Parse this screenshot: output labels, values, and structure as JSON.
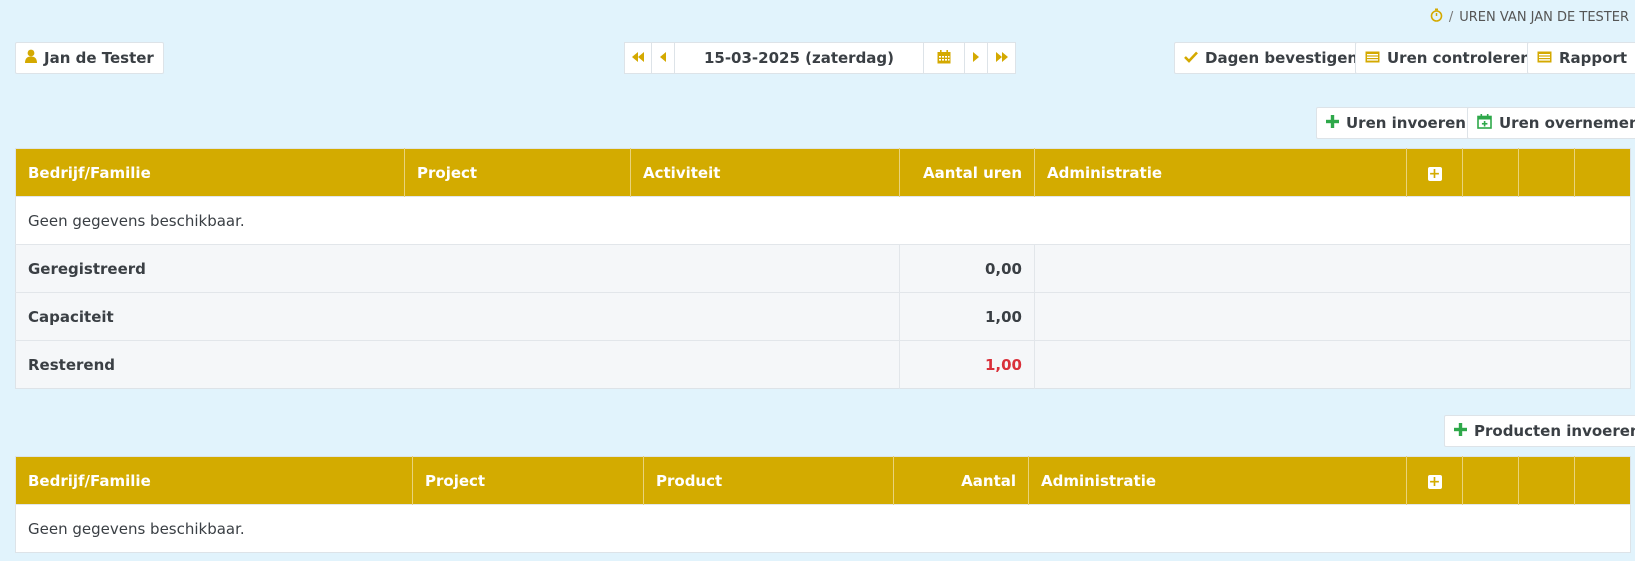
{
  "breadcrumb": {
    "icon": "stopwatch-icon",
    "separator": "/",
    "label": "UREN VAN JAN DE TESTER"
  },
  "user_button": {
    "icon": "user-icon",
    "label": "Jan de Tester"
  },
  "date_nav": {
    "first_icon": "double-chevron-left-icon",
    "prev_icon": "chevron-left-icon",
    "date": "15-03-2025 (zaterdag)",
    "calendar_icon": "calendar-icon",
    "next_icon": "chevron-right-icon",
    "last_icon": "double-chevron-right-icon"
  },
  "toolbar": {
    "confirm_days": "Dagen bevestigen",
    "check_hours": "Uren controleren",
    "report": "Rapport"
  },
  "hours_actions": {
    "enter_hours": "Uren invoeren",
    "copy_hours": "Uren overnemen"
  },
  "hours_table": {
    "columns": [
      "Bedrijf/Familie",
      "Project",
      "Activiteit",
      "Aantal uren",
      "Administratie"
    ],
    "empty_text": "Geen gegevens beschikbaar.",
    "summary": [
      {
        "label": "Geregistreerd",
        "value": "0,00"
      },
      {
        "label": "Capaciteit",
        "value": "1,00"
      },
      {
        "label": "Resterend",
        "value": "1,00"
      }
    ]
  },
  "products_actions": {
    "enter_products": "Producten invoeren"
  },
  "products_table": {
    "columns": [
      "Bedrijf/Familie",
      "Project",
      "Product",
      "Aantal",
      "Administratie"
    ],
    "empty_text": "Geen gegevens beschikbaar."
  },
  "colors": {
    "header": "#d3ab00",
    "accent_green": "#2ea84a",
    "negative": "#d9303a",
    "background": "#e1f3fc"
  }
}
